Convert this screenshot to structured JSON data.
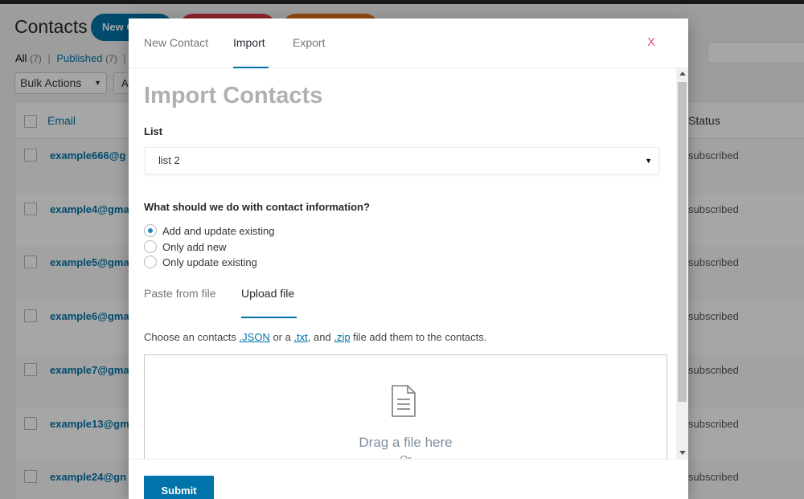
{
  "background": {
    "page_title": "Contacts",
    "header_buttons": [
      "New C",
      "",
      ""
    ],
    "filters": {
      "all_label": "All",
      "all_count": "(7)",
      "separator": "|",
      "published_label": "Published",
      "published_count": "(7)",
      "trailing": "|"
    },
    "bulk_actions": "Bulk Actions",
    "apply_label": "A",
    "columns": {
      "email": "Email",
      "status": "Status"
    },
    "rows": [
      {
        "email": "example666@g",
        "status": "subscribed"
      },
      {
        "email": "example4@gma",
        "status": "subscribed"
      },
      {
        "email": "example5@gma",
        "status": "subscribed"
      },
      {
        "email": "example6@gma",
        "status": "subscribed"
      },
      {
        "email": "example7@gma",
        "status": "subscribed"
      },
      {
        "email": "example13@gm",
        "status": "subscribed"
      },
      {
        "email": "example24@gn",
        "status": "subscribed"
      }
    ]
  },
  "modal": {
    "tabs": [
      "New Contact",
      "Import",
      "Export"
    ],
    "active_tab": "Import",
    "close_label": "X",
    "title": "Import Contacts",
    "list_label": "List",
    "list_selected": "list 2",
    "contact_question": "What should we do with contact information?",
    "options": [
      {
        "label": "Add and update existing",
        "checked": true
      },
      {
        "label": "Only add new",
        "checked": false
      },
      {
        "label": "Only update existing",
        "checked": false
      }
    ],
    "source_tabs": [
      "Paste from file",
      "Upload file"
    ],
    "active_source_tab": "Upload file",
    "help": {
      "prefix": "Choose an contacts ",
      "json": ".JSON",
      "mid1": " or a ",
      "txt": ".txt",
      "mid2": ", and ",
      "zip": ".zip",
      "suffix": " file add them to the contacts."
    },
    "dropzone": {
      "drag_text": "Drag a file here",
      "or_text": "Or"
    },
    "submit_label": "Submit"
  },
  "colors": {
    "accent": "#0073aa",
    "close": "#e8506e",
    "title_gray": "#b0b0b0",
    "red_button": "#dc3545",
    "orange_button": "#e0701a"
  },
  "icons": [
    "file-icon",
    "dropdown-arrow-icon",
    "scroll-up-icon",
    "scroll-down-icon"
  ]
}
